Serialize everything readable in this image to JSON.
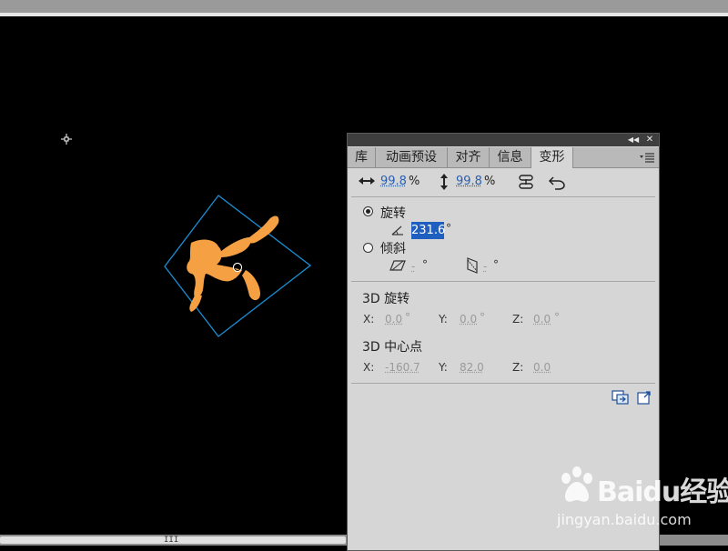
{
  "panel": {
    "tabs": [
      "库",
      "动画预设",
      "对齐",
      "信息",
      "变形"
    ],
    "active_tab": "变形",
    "scale": {
      "width": "99.8",
      "height": "99.8",
      "unit": "%"
    },
    "rotate": {
      "label": "旋转",
      "value": "231.6",
      "unit": "°",
      "selected": true
    },
    "skew": {
      "label": "倾斜",
      "h_value": "-",
      "v_value": "-",
      "unit": "°"
    },
    "rotation3d": {
      "label": "3D 旋转",
      "x_label": "X:",
      "x": "0.0",
      "y_label": "Y:",
      "y": "0.0",
      "z_label": "Z:",
      "z": "0.0",
      "unit": "°"
    },
    "center3d": {
      "label": "3D 中心点",
      "x_label": "X:",
      "x": "-160.7",
      "y_label": "Y:",
      "y": "82.0",
      "z_label": "Z:",
      "z": "0.0"
    }
  },
  "stage": {
    "background": "#000000",
    "shape_color": "#f5a043",
    "bbox_color": "#1a8fd6"
  },
  "scrollbar": {
    "grip": "III"
  },
  "watermark": {
    "brand": "Baidu经验",
    "url": "jingyan.baidu.com"
  }
}
